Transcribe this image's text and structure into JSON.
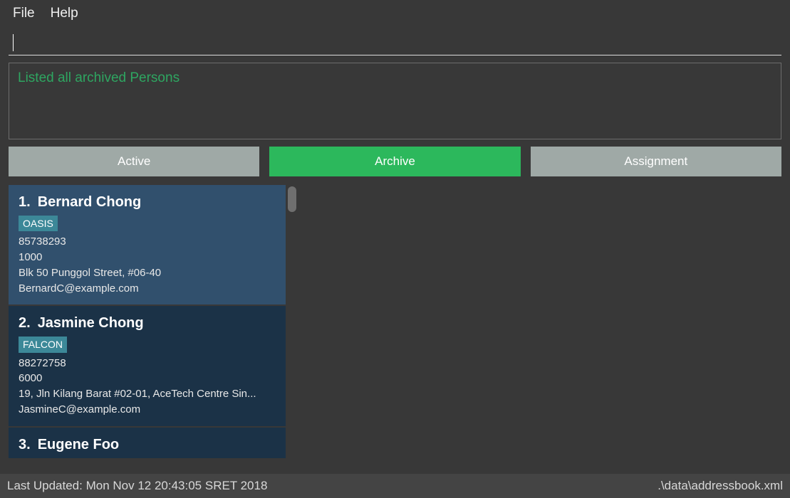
{
  "menu": {
    "file": "File",
    "help": "Help"
  },
  "command_input": {
    "value": "",
    "placeholder": ""
  },
  "result_message": "Listed all archived Persons",
  "tabs": {
    "active": "Active",
    "archive": "Archive",
    "assignment": "Assignment",
    "selected": "archive"
  },
  "persons": [
    {
      "index": "1.",
      "name": "Bernard Chong",
      "tag": "OASIS",
      "phone": "85738293",
      "salary": "1000",
      "address": "Blk 50 Punggol Street, #06-40",
      "email": "BernardC@example.com",
      "selected": true
    },
    {
      "index": "2.",
      "name": "Jasmine Chong",
      "tag": "FALCON",
      "phone": "88272758",
      "salary": "6000",
      "address": "19, Jln Kilang Barat #02-01, AceTech Centre Sin...",
      "email": "JasmineC@example.com",
      "selected": false
    },
    {
      "index": "3.",
      "name": "Eugene Foo",
      "tag": "",
      "phone": "",
      "salary": "",
      "address": "",
      "email": "",
      "selected": false
    }
  ],
  "footer": {
    "last_updated": "Last Updated: Mon Nov 12 20:43:05 SRET 2018",
    "file_path": ".\\data\\addressbook.xml"
  }
}
